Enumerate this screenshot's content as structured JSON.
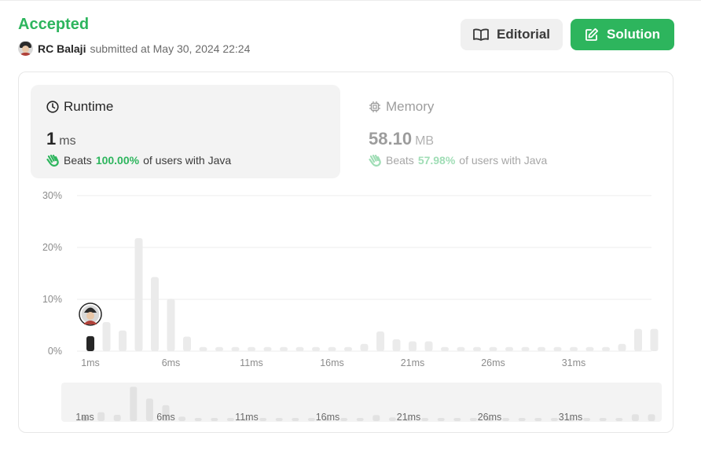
{
  "submission": {
    "status": "Accepted",
    "user": "RC Balaji",
    "submitted_text": "submitted at May 30, 2024 22:24"
  },
  "buttons": {
    "editorial_label": "Editorial",
    "solution_label": "Solution"
  },
  "runtime": {
    "label": "Runtime",
    "value": "1",
    "unit": "ms",
    "beats_label": "Beats",
    "beats_pct": "100.00%",
    "beats_suffix": "of users with Java"
  },
  "memory": {
    "label": "Memory",
    "value": "58.10",
    "unit": "MB",
    "beats_label": "Beats",
    "beats_pct": "57.98%",
    "beats_suffix": "of users with Java"
  },
  "colors": {
    "accent_green": "#2db55d",
    "bar_gray": "#ebebeb",
    "bar_highlight": "#262626"
  },
  "chart_data": {
    "type": "bar",
    "ylabel_ticks": [
      "30%",
      "20%",
      "10%",
      "0%"
    ],
    "ylim": [
      0,
      30
    ],
    "x_tick_labels": [
      "1ms",
      "6ms",
      "11ms",
      "16ms",
      "21ms",
      "26ms",
      "31ms"
    ],
    "x": [
      1,
      2,
      3,
      4,
      5,
      6,
      7,
      8,
      9,
      10,
      11,
      12,
      13,
      14,
      15,
      16,
      17,
      18,
      19,
      20,
      21,
      22,
      23,
      24,
      25,
      26,
      27,
      28,
      29,
      30,
      31,
      32,
      33,
      34,
      35,
      36
    ],
    "values": [
      2.9,
      5.6,
      4.0,
      21.8,
      14.3,
      10.1,
      2.8,
      0.8,
      0.8,
      0.8,
      0.8,
      0.8,
      0.8,
      0.8,
      0.8,
      0.8,
      0.8,
      1.4,
      3.8,
      2.3,
      1.9,
      1.9,
      0.8,
      0.8,
      0.8,
      0.8,
      0.8,
      0.8,
      0.8,
      0.8,
      0.8,
      0.8,
      0.8,
      1.4,
      4.3,
      4.3
    ],
    "highlight_index": 0,
    "grid": true
  }
}
